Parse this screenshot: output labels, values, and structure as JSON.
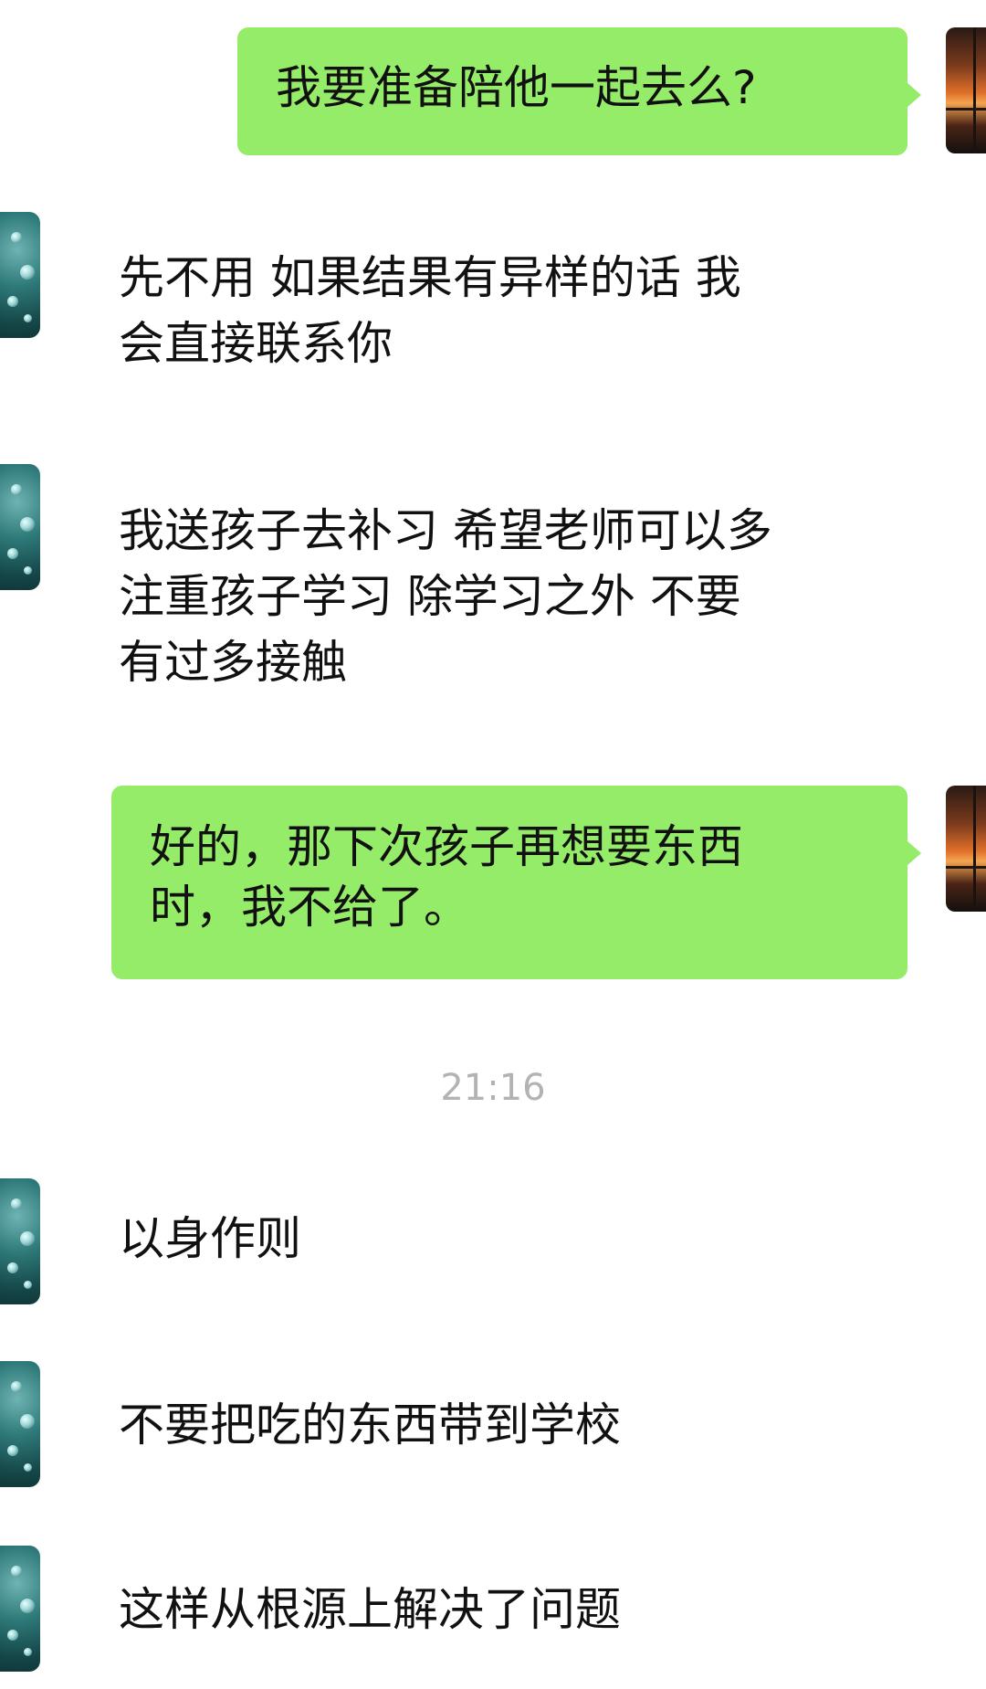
{
  "messages": [
    {
      "id": "msg-1",
      "sender": "self",
      "text": "我要准备陪他一起去么?"
    },
    {
      "id": "msg-2",
      "sender": "other",
      "text": "先不用 如果结果有异样的话 我\n会直接联系你"
    },
    {
      "id": "msg-3",
      "sender": "other",
      "text": "我送孩子去补习 希望老师可以多\n注重孩子学习 除学习之外 不要\n有过多接触"
    },
    {
      "id": "msg-4",
      "sender": "self",
      "text": "好的，那下次孩子再想要东西\n时，我不给了。"
    },
    {
      "id": "msg-5",
      "sender": "other",
      "text": "以身作则"
    },
    {
      "id": "msg-6",
      "sender": "other",
      "text": "不要把吃的东西带到学校"
    },
    {
      "id": "msg-7",
      "sender": "other",
      "text": "这样从根源上解决了问题"
    }
  ],
  "timestamp": "21:16",
  "colors": {
    "outgoing_bubble": "#95ec69",
    "incoming_bubble": "#ffffff",
    "timestamp_text": "#b3b3b3"
  }
}
